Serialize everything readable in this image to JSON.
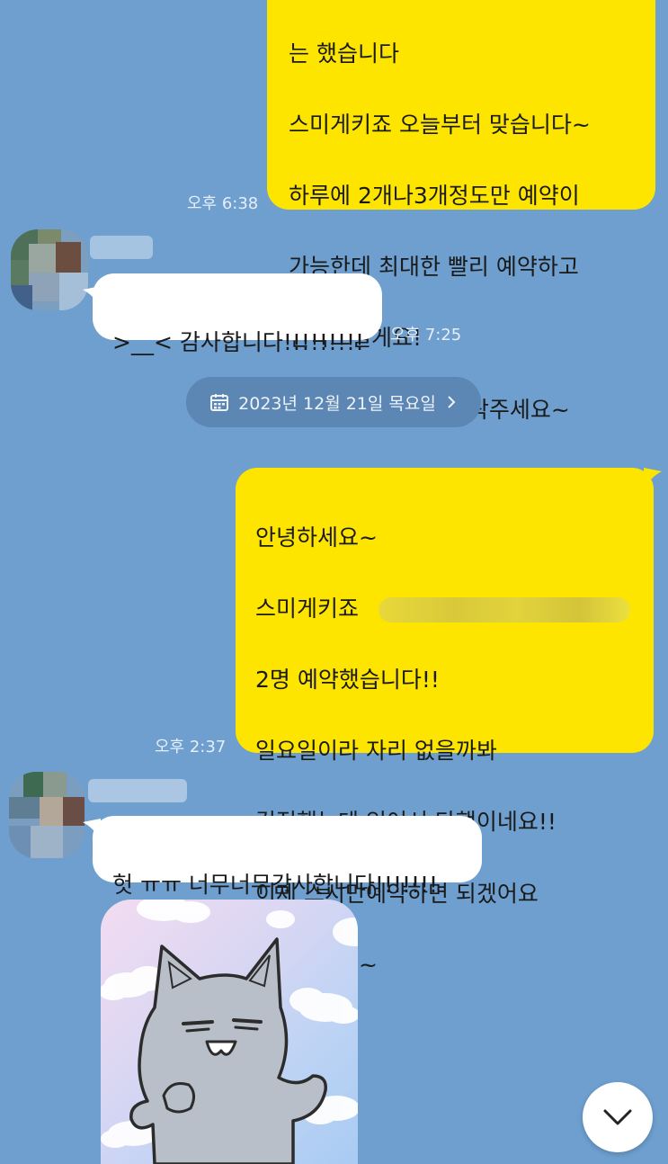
{
  "messages": [
    {
      "id": "m1",
      "from": "me",
      "lines": [
        "는 했습니다",
        "스미게키죠 오늘부터 맞습니다~",
        "하루에 2개나3개정도만 예약이",
        "가능한데 최대한 빨리 예약하고",
        "연락드릴게요!",
        "스시는 정해지면 연락주세요~"
      ],
      "time": "오후 6:38"
    },
    {
      "id": "m2",
      "from": "other",
      "lines": [
        ">__< 감사합니다!!!!!!!!!"
      ],
      "time": "오후 7:25"
    },
    {
      "id": "m3",
      "from": "me",
      "lines": [
        "안녕하세요~",
        "스미게키죠",
        "2명 예약했습니다!!",
        "일요일이라 자리 없을까봐",
        "걱정했는데 있어서 다행이네요!!",
        "이제 스시만예약하면 되겠어요",
        "연락주세요~"
      ],
      "time": "오후 2:37"
    },
    {
      "id": "m4",
      "from": "other",
      "lines": [
        "헛 ㅠㅠ 너무너무감사합니다!!!!!!!"
      ],
      "time": ""
    }
  ],
  "date_divider": {
    "label": "2023년 12월 21일 목요일",
    "icon": "calendar-icon",
    "chevron": "chevron-right-icon"
  },
  "sticker": {
    "name": "gray-cat-sticker"
  },
  "scroll_button": {
    "icon": "chevron-down-icon"
  },
  "colors": {
    "background": "#6e9fcf",
    "my_bubble": "#fee500",
    "other_bubble": "#ffffff",
    "date_pill": "#5c86b3"
  }
}
